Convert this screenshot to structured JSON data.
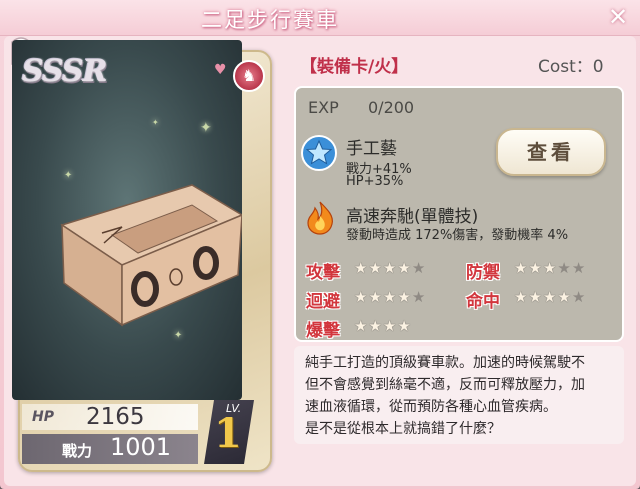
{
  "window": {
    "title": "二足步行賽車",
    "close_icon": "close-icon"
  },
  "card": {
    "rarity": "SSSR",
    "element_icon": "fire-element-icon",
    "hp_label": "HP",
    "hp_value": "2165",
    "power_label": "戰力",
    "power_value": "1001",
    "level_label": "LV.",
    "level_value": "1"
  },
  "header": {
    "type_label": "【裝備卡/火】",
    "cost_label": "Cost：0"
  },
  "exp": {
    "label": "EXP",
    "value": "0/200"
  },
  "skills": [
    {
      "icon": "blue-star-skill-icon",
      "name": "手工藝",
      "lines": [
        "戰力+41%",
        "HP+35%"
      ]
    },
    {
      "icon": "fire-skill-icon",
      "name": "高速奔馳(單體技)",
      "lines": [
        "發動時造成 172%傷害，發動機率 4%"
      ]
    }
  ],
  "view_button": {
    "label": "查看"
  },
  "stats": [
    {
      "label": "攻擊",
      "stars": 4,
      "max": 5
    },
    {
      "label": "防禦",
      "stars": 3,
      "max": 5
    },
    {
      "label": "迴避",
      "stars": 4,
      "max": 5
    },
    {
      "label": "命中",
      "stars": 4,
      "max": 5
    },
    {
      "label": "爆擊",
      "stars": 4,
      "max": 4
    }
  ],
  "description": [
    "純手工打造的頂級賽車款。加速的時候駕駛不",
    "但不會感覺到絲毫不適，反而可釋放壓力，加",
    "速血液循環，從而預防各種心血管疾病。",
    "是不是從根本上就搞錯了什麼？"
  ],
  "colors": {
    "accent": "#d2363d",
    "frame": "#f5cdd6",
    "panel": "#bcb8ad"
  }
}
